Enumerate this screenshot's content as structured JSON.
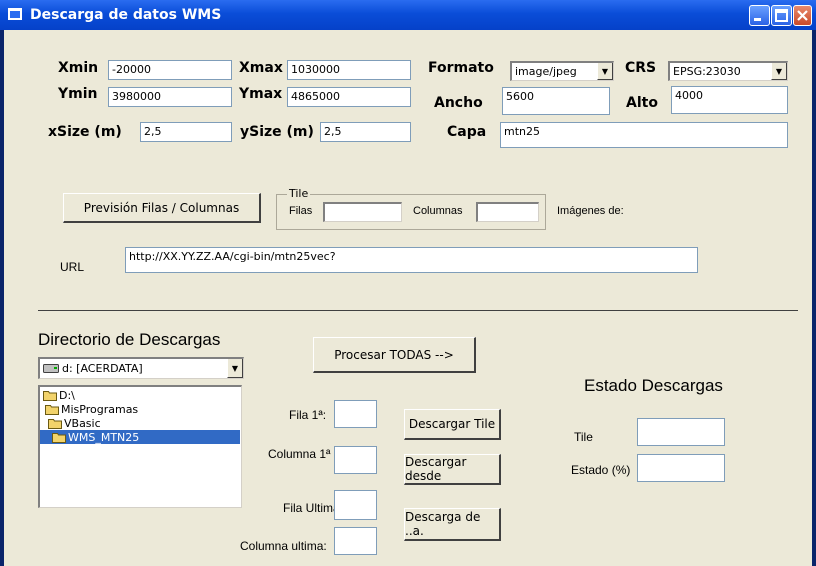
{
  "window": {
    "title": "Descarga de datos WMS"
  },
  "coords": {
    "xmin_label": "Xmin",
    "xmin_value": "-20000",
    "xmax_label": "Xmax",
    "xmax_value": "1030000",
    "ymin_label": "Ymin",
    "ymin_value": "3980000",
    "ymax_label": "Ymax",
    "ymax_value": "4865000",
    "xsize_label": "xSize (m)",
    "xsize_value": "2,5",
    "ysize_label": "ySize (m)",
    "ysize_value": "2,5"
  },
  "format": {
    "formato_label": "Formato",
    "formato_value": "image/jpeg",
    "crs_label": "CRS",
    "crs_value": "EPSG:23030",
    "ancho_label": "Ancho",
    "ancho_value": "5600",
    "alto_label": "Alto",
    "alto_value": "4000",
    "capa_label": "Capa",
    "capa_value": "mtn25"
  },
  "tile": {
    "prevision_button": "Previsión Filas / Columnas",
    "frame_label": "Tile",
    "filas_label": "Filas",
    "filas_value": "",
    "columnas_label": "Columnas",
    "columnas_value": "",
    "imagenes_label": "Imágenes de:"
  },
  "url": {
    "label": "URL",
    "value": "http://XX.YY.ZZ.AA/cgi-bin/mtn25vec?"
  },
  "directory": {
    "title": "Directorio de Descargas",
    "drive_value": "d: [ACERDATA]",
    "folders": [
      {
        "label": "D:\\",
        "indent": 0,
        "selected": false
      },
      {
        "label": "MisProgramas",
        "indent": 1,
        "selected": false
      },
      {
        "label": "VBasic",
        "indent": 2,
        "selected": false
      },
      {
        "label": "WMS_MTN25",
        "indent": 3,
        "selected": true
      }
    ]
  },
  "process": {
    "procesar_button": "Procesar TODAS -->",
    "fila1_label": "Fila 1ª:",
    "columna1_label": "Columna 1ª",
    "fila_ultima_label": "Fila Ultima:",
    "columna_ultima_label": "Columna ultima:",
    "descargar_tile_button": "Descargar Tile",
    "descargar_desde_button": "Descargar desde",
    "descarga_de_button": "Descarga de ..a."
  },
  "status": {
    "title": "Estado Descargas",
    "tile_label": "Tile",
    "tile_value": "",
    "estado_label": "Estado (%)",
    "estado_value": ""
  }
}
